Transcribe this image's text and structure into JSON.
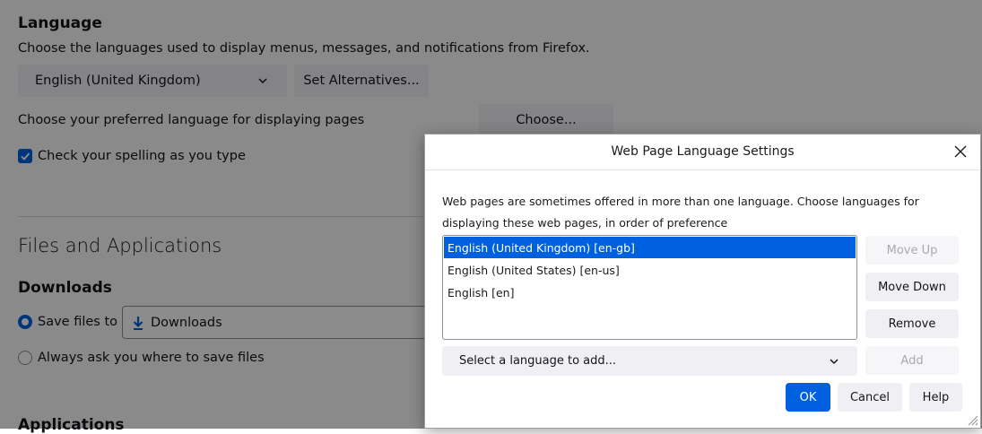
{
  "language": {
    "heading": "Language",
    "description": "Choose the languages used to display menus, messages, and notifications from Firefox.",
    "ui_language_selected": "English (United Kingdom)",
    "set_alternatives_button": "Set Alternatives...",
    "page_language_text": "Choose your preferred language for displaying pages",
    "choose_button": "Choose...",
    "spellcheck_label": "Check your spelling as you type",
    "spellcheck_checked": true
  },
  "files": {
    "heading": "Files and Applications",
    "downloads_heading": "Downloads",
    "save_files_label": "Save files to",
    "save_folder": "Downloads",
    "always_ask_label": "Always ask you where to save files",
    "save_files_selected": true,
    "applications_heading": "Applications"
  },
  "dialog": {
    "title": "Web Page Language Settings",
    "description": "Web pages are sometimes offered in more than one language. Choose languages for displaying these web pages, in order of preference",
    "languages": [
      {
        "label": "English (United Kingdom)  [en-gb]",
        "selected": true
      },
      {
        "label": "English (United States)  [en-us]",
        "selected": false
      },
      {
        "label": "English  [en]",
        "selected": false
      }
    ],
    "move_up_button": "Move Up",
    "move_down_button": "Move Down",
    "remove_button": "Remove",
    "add_language_placeholder": "Select a language to add...",
    "add_button": "Add",
    "ok_button": "OK",
    "cancel_button": "Cancel",
    "help_button": "Help"
  },
  "colors": {
    "accent": "#0061e0",
    "overlay": "rgba(0,0,0,0.45)"
  }
}
